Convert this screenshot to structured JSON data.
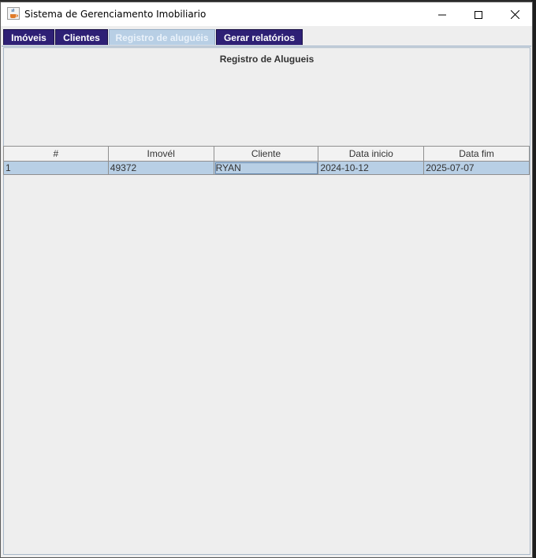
{
  "window": {
    "title": "Sistema de Gerenciamento Imobiliario"
  },
  "tabs": [
    {
      "label": "Imóveis",
      "active": false
    },
    {
      "label": "Clientes",
      "active": false
    },
    {
      "label": "Registro de aluguéis",
      "active": true
    },
    {
      "label": "Gerar relatórios",
      "active": false
    }
  ],
  "panel": {
    "title": "Registro de Alugueis"
  },
  "table": {
    "columns": [
      "#",
      "Imovél",
      "Cliente",
      "Data inicio",
      "Data fim"
    ],
    "rows": [
      [
        "1",
        "49372",
        "RYAN",
        "2024-10-12",
        "2025-07-07"
      ]
    ]
  },
  "colors": {
    "tab_bg": "#2e2075",
    "tab_active_bg": "#b8cfe5",
    "row_selected_bg": "#b8cfe5",
    "panel_bg": "#eeeeee"
  },
  "icons": {
    "app": "java-coffee-cup-icon",
    "minimize": "minimize-icon",
    "maximize": "maximize-icon",
    "close": "close-icon"
  }
}
